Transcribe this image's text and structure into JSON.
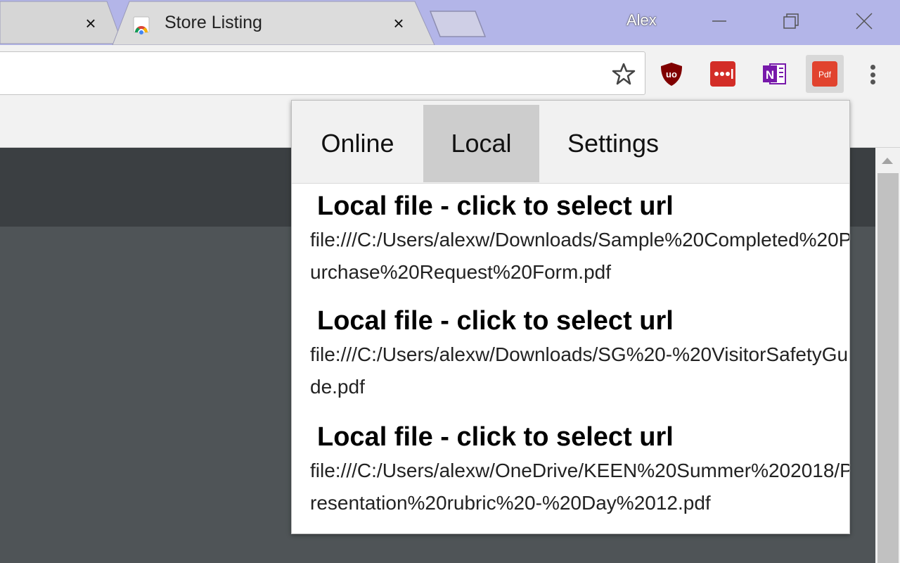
{
  "browser": {
    "tab_active_title": "Store Listing",
    "profile_name": "Alex",
    "tab_close_glyph": "×",
    "colors": {
      "tabstrip": "#b3b5e8",
      "ublock_red": "#800000",
      "lastpass_red": "#d32d27",
      "onenote_purple": "#7719aa",
      "pdf_red": "#e1432e"
    }
  },
  "toolbar": {
    "bookmark_icon": "star-outline-icon",
    "extensions": [
      {
        "name": "ublock-origin",
        "label": "uo"
      },
      {
        "name": "lastpass",
        "label": "•••|"
      },
      {
        "name": "onenote",
        "label": "N"
      },
      {
        "name": "pdf-converter",
        "label": "Pdf"
      }
    ]
  },
  "popup": {
    "tabs": [
      {
        "label": "Online",
        "active": false
      },
      {
        "label": "Local",
        "active": true
      },
      {
        "label": "Settings",
        "active": false
      }
    ],
    "entries": [
      {
        "title": "Local file - click to select url",
        "url": "file:///C:/Users/alexw/Downloads/Sample%20Completed%20Purchase%20Request%20Form.pdf"
      },
      {
        "title": "Local file - click to select url",
        "url": "file:///C:/Users/alexw/Downloads/SG%20-%20VisitorSafetyGuide.pdf"
      },
      {
        "title": "Local file - click to select url",
        "url": "file:///C:/Users/alexw/OneDrive/KEEN%20Summer%202018/Presentation%20rubric%20-%20Day%2012.pdf"
      }
    ]
  }
}
